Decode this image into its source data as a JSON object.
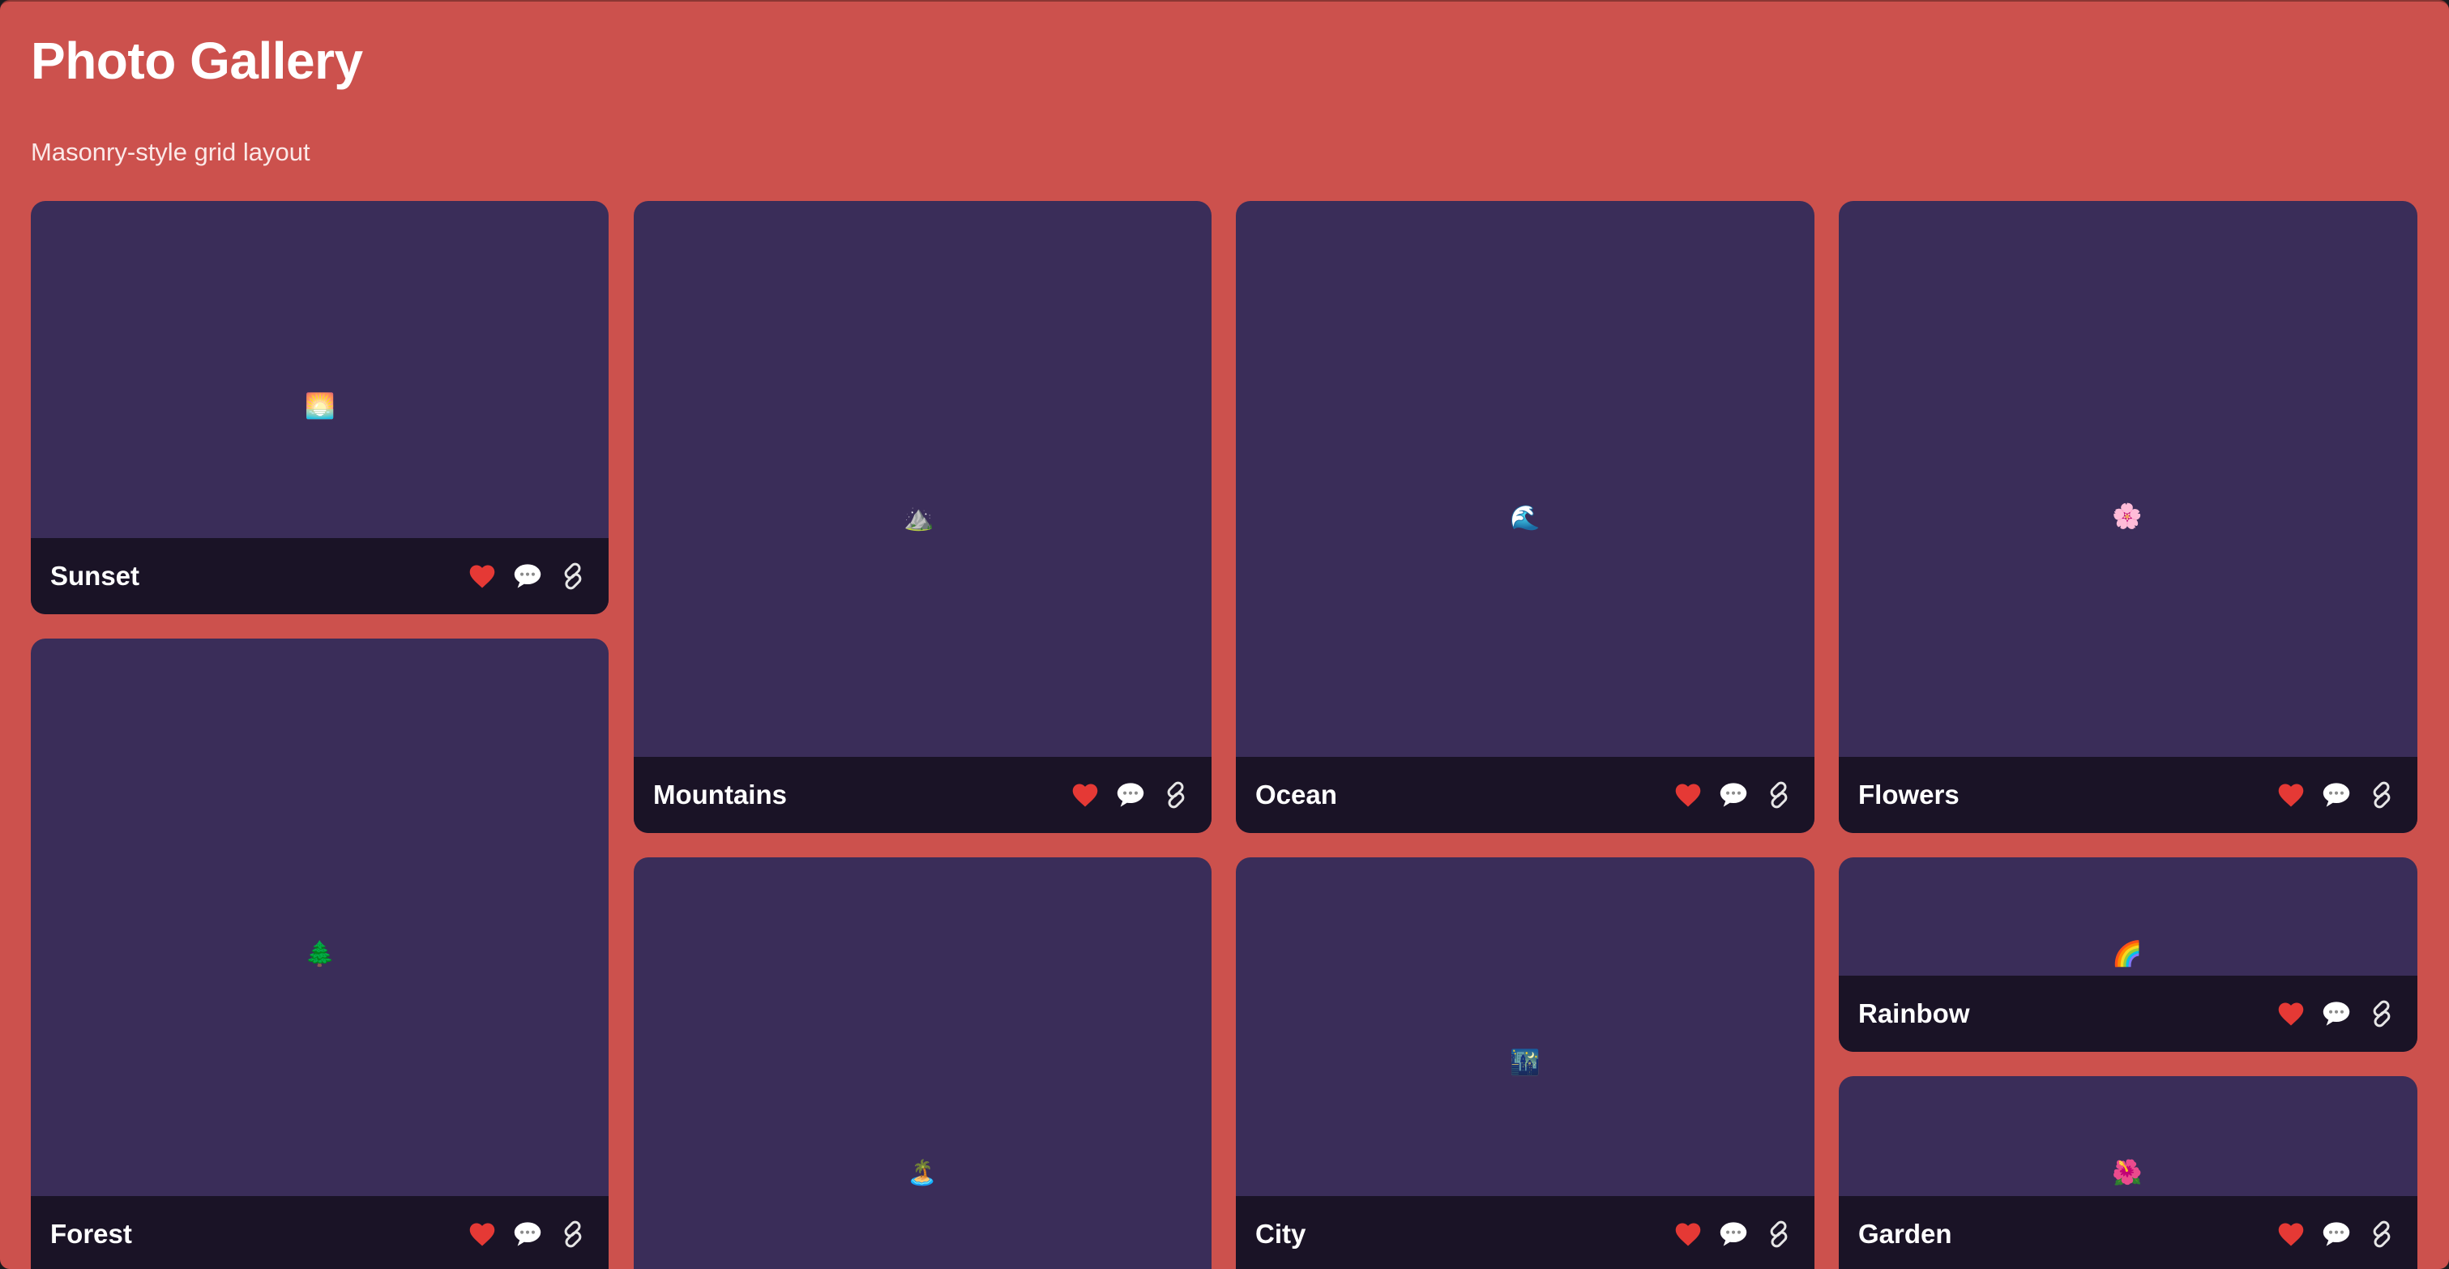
{
  "header": {
    "title": "Photo Gallery",
    "subtitle": "Masonry-style grid layout"
  },
  "colors": {
    "background": "#cc514d",
    "card": "#3a2d59",
    "caption_bar": "#1a1326",
    "heart": "#e53935"
  },
  "gallery": [
    {
      "title": "Sunset",
      "emoji": "🌅",
      "icon": "sunset-icon"
    },
    {
      "title": "Forest",
      "emoji": "🌲",
      "icon": "tree-icon"
    },
    {
      "title": "Mountains",
      "emoji": "⛰️",
      "icon": "mountain-icon"
    },
    {
      "title": "",
      "emoji": "🏝️",
      "icon": "island-icon"
    },
    {
      "title": "Ocean",
      "emoji": "🌊",
      "icon": "wave-icon"
    },
    {
      "title": "City",
      "emoji": "🌃",
      "icon": "city-night-icon"
    },
    {
      "title": "Flowers",
      "emoji": "🌸",
      "icon": "blossom-icon"
    },
    {
      "title": "Rainbow",
      "emoji": "🌈",
      "icon": "rainbow-icon"
    },
    {
      "title": "Garden",
      "emoji": "🌺",
      "icon": "hibiscus-icon"
    }
  ],
  "actions": {
    "like_icon": "heart-icon",
    "comment_icon": "speech-bubble-icon",
    "link_icon": "link-icon"
  }
}
